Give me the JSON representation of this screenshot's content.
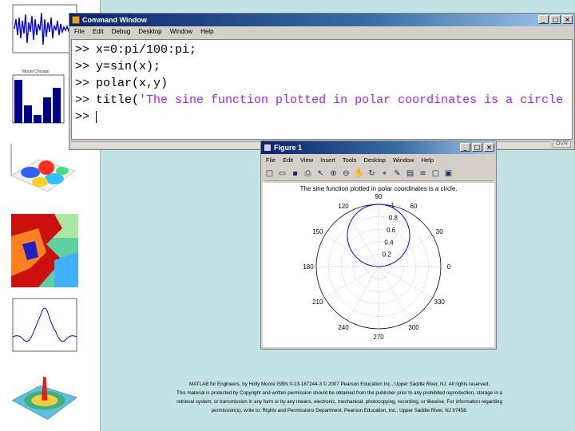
{
  "command_window": {
    "title": "Command Window",
    "menu": [
      "File",
      "Edit",
      "Debug",
      "Desktop",
      "Window",
      "Help"
    ],
    "prompt": ">>",
    "lines": [
      {
        "code": "x=0:pi/100:pi;",
        "string": ""
      },
      {
        "code": "y=sin(x);",
        "string": ""
      },
      {
        "code": "polar(x,y)",
        "string": ""
      },
      {
        "code": "title(",
        "string": "'The sine function plotted in polar coordinates is a circle"
      }
    ],
    "status": "OVR"
  },
  "figure_window": {
    "title": "Figure 1",
    "menu": [
      "File",
      "Edit",
      "View",
      "Insert",
      "Tools",
      "Desktop",
      "Window",
      "Help"
    ],
    "toolbar_icons": [
      "new-file-icon",
      "open-folder-icon",
      "save-icon",
      "print-icon",
      "pointer-icon",
      "zoom-in-icon",
      "zoom-out-icon",
      "pan-icon",
      "rotate-icon",
      "data-cursor-icon",
      "brush-icon",
      "colorbar-icon",
      "legend-icon",
      "hide-tools-icon",
      "show-tools-icon"
    ],
    "toolbar_glyphs": [
      "□",
      "▭",
      "▪",
      "⎙",
      "↖",
      "⊕",
      "⊖",
      "✋",
      "↻",
      "⌖",
      "✎",
      "▤",
      "≡",
      "▢",
      "▣"
    ]
  },
  "chart_data": {
    "type": "polar",
    "title": "The sine function plotted in polar coordinates is a circle.",
    "r_ticks": [
      "0.2",
      "0.4",
      "0.6",
      "0.8",
      "1"
    ],
    "theta_ticks": [
      "0",
      "30",
      "60",
      "90",
      "120",
      "150",
      "180",
      "210",
      "240",
      "270",
      "300",
      "330"
    ],
    "series": [
      {
        "theta_range_rad": [
          0,
          3.14159
        ],
        "r_function": "sin(theta)",
        "color": "#0000ff"
      }
    ]
  },
  "footer": {
    "line1": "MATLAB for Engineers, by Holly Moore ISBN 0-13-187244-3 © 2007 Pearson Education Inc., Upper Saddle River, NJ. All rights reserved.",
    "line2": "This material is protected by Copyright and written permission should be obtained from the publisher prior to any prohibited reproduction, storage in a",
    "line3": "retrieval system, or transmission in any form or by any means, electronic, mechanical, photocopying, recording, or likewise. For information regarding",
    "line4": "permission(s), write to: Rights and Permissions Department, Pearson Education, Inc., Upper Saddle River, NJ 07458."
  },
  "thumbnails": {
    "bar_title": "Mount Chicago"
  },
  "colors": {
    "background": "#c3e2e3",
    "titlebar": "#0a246a",
    "string": "#a020f0",
    "plot_line": "#0000ff"
  }
}
